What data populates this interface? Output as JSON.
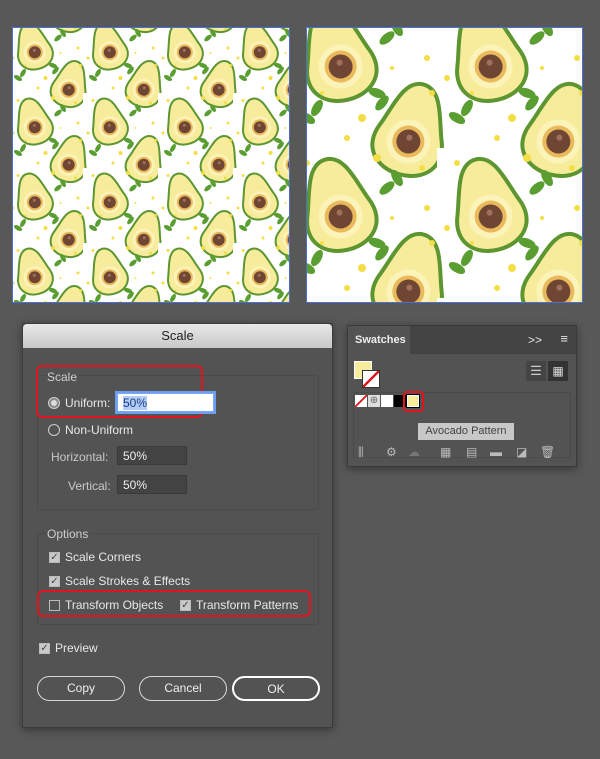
{
  "artboards": [
    {
      "name": "pattern-50-percent"
    },
    {
      "name": "pattern-100-percent"
    }
  ],
  "colors": {
    "avocado_skin": "#5d9630",
    "avocado_flesh": "#f7ec9c",
    "avocado_inner": "#fbf3b8",
    "pit": "#6e4633",
    "pit_ring": "#e9b95c",
    "leaf": "#5a9e32",
    "dot": "#f3df45",
    "highlight": "#e0141e"
  },
  "dialog": {
    "title": "Scale",
    "scale_group": {
      "label": "Scale",
      "uniform_label": "Uniform:",
      "uniform_value": "50%",
      "non_uniform_label": "Non-Uniform",
      "horizontal_label": "Horizontal:",
      "horizontal_value": "50%",
      "vertical_label": "Vertical:",
      "vertical_value": "50%",
      "selected": "uniform"
    },
    "options_group": {
      "label": "Options",
      "scale_corners": {
        "label": "Scale Corners",
        "checked": true
      },
      "scale_strokes": {
        "label": "Scale Strokes & Effects",
        "checked": true
      },
      "transform_objects": {
        "label": "Transform Objects",
        "checked": false
      },
      "transform_patterns": {
        "label": "Transform Patterns",
        "checked": true
      }
    },
    "preview": {
      "label": "Preview",
      "checked": true
    },
    "buttons": {
      "copy": "Copy",
      "cancel": "Cancel",
      "ok": "OK"
    }
  },
  "swatches": {
    "tab": "Swatches",
    "expand": ">>",
    "tooltip": "Avocado Pattern",
    "items": [
      "None",
      "Registration",
      "White",
      "Black",
      "Avocado Pattern"
    ]
  }
}
